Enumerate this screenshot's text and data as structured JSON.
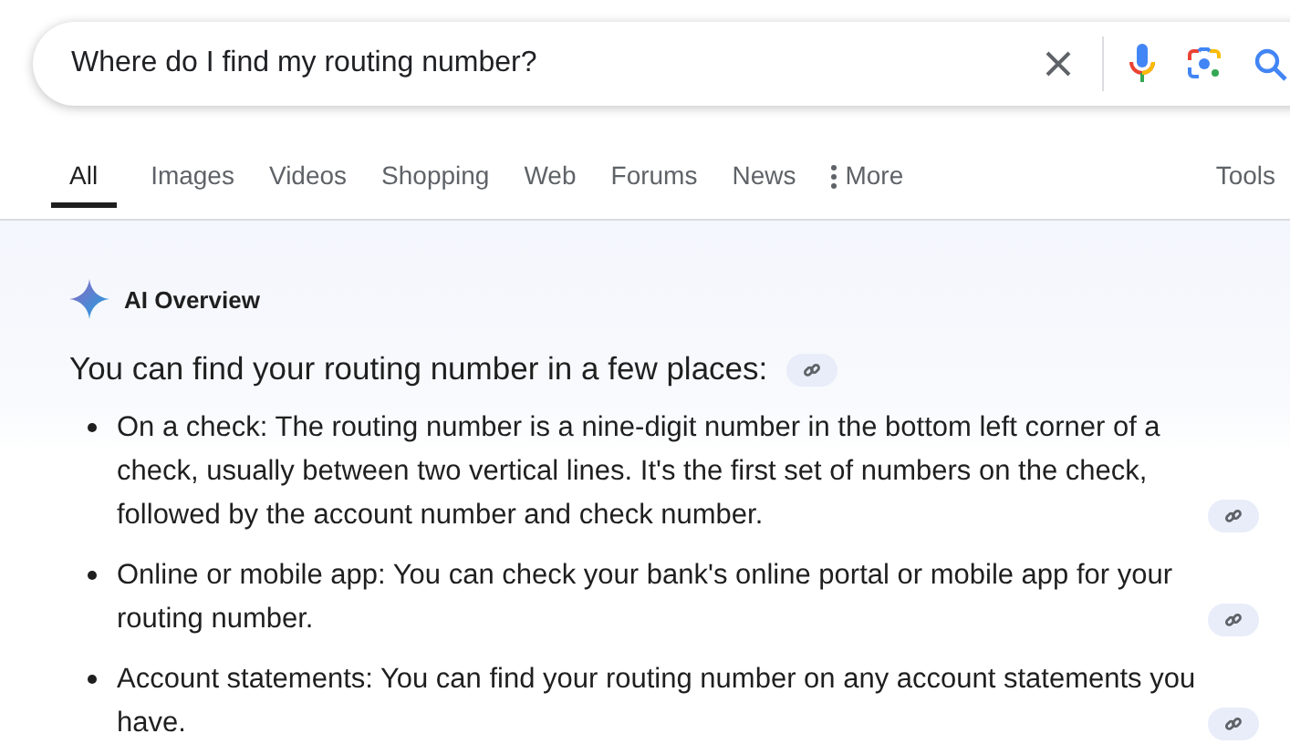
{
  "search": {
    "value": "Where do I find my routing number?"
  },
  "tabs": [
    {
      "label": "All",
      "selected": true,
      "kind": "plain"
    },
    {
      "label": "Images",
      "selected": false,
      "kind": "plain"
    },
    {
      "label": "Videos",
      "selected": false,
      "kind": "plain"
    },
    {
      "label": "Shopping",
      "selected": false,
      "kind": "plain"
    },
    {
      "label": "Web",
      "selected": false,
      "kind": "plain"
    },
    {
      "label": "Forums",
      "selected": false,
      "kind": "plain"
    },
    {
      "label": "News",
      "selected": false,
      "kind": "plain"
    },
    {
      "label": "More",
      "selected": false,
      "kind": "menu"
    }
  ],
  "tools": "Tools",
  "overview": {
    "title": "AI Overview",
    "intro": "You can find your routing number in a few places:",
    "bullets": [
      "On a check: The routing number is a nine-digit number in the bottom left corner of a check, usually between two vertical lines. It's the first set of numbers on the check, followed by the account number and check number.",
      "Online or mobile app: You can check your bank's online portal or mobile app for your routing number.",
      "Account statements: You can find your routing number on any account statements you have."
    ]
  }
}
